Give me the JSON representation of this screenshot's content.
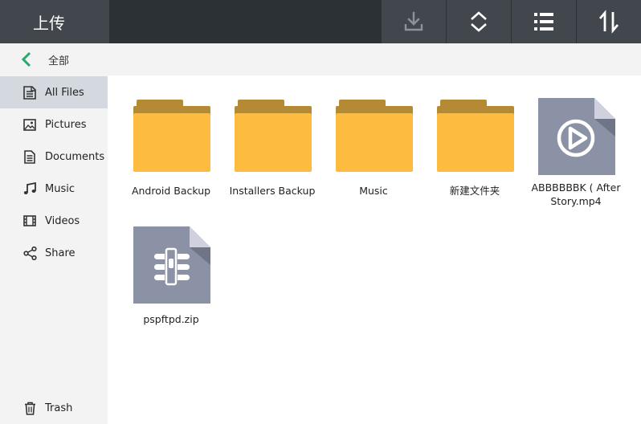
{
  "app": {
    "title": "上传"
  },
  "toolbar": {
    "buttons": [
      {
        "name": "upload-button",
        "icon": "download-icon",
        "color": "#8c9298"
      },
      {
        "name": "sort-order-button",
        "icon": "chevron-up-down-icon",
        "color": "#ffffff"
      },
      {
        "name": "list-view-button",
        "icon": "list-icon",
        "color": "#ffffff"
      },
      {
        "name": "sort-button",
        "icon": "sort-arrows-icon",
        "color": "#ffffff"
      }
    ]
  },
  "breadcrumb": {
    "back_icon": "chevron-left-icon",
    "current": "全部",
    "accent": "#27a96a"
  },
  "sidebar": {
    "items": [
      {
        "label": "All Files",
        "icon": "all-files-icon",
        "active": true
      },
      {
        "label": "Pictures",
        "icon": "picture-icon",
        "active": false
      },
      {
        "label": "Documents",
        "icon": "document-icon",
        "active": false
      },
      {
        "label": "Music",
        "icon": "music-note-icon",
        "active": false
      },
      {
        "label": "Videos",
        "icon": "film-icon",
        "active": false
      },
      {
        "label": "Share",
        "icon": "share-icon",
        "active": false
      }
    ],
    "trash": {
      "label": "Trash",
      "icon": "trash-icon"
    }
  },
  "files": {
    "items": [
      {
        "name": "Android Backup",
        "type": "folder"
      },
      {
        "name": "Installers Backup",
        "type": "folder"
      },
      {
        "name": "Music",
        "type": "folder"
      },
      {
        "name": "新建文件夹",
        "type": "folder"
      },
      {
        "name_line1": "ABBBBBBK ( After",
        "name_line2": "Story.mp4",
        "type": "video"
      },
      {
        "name": "pspftpd.zip",
        "type": "archive"
      }
    ],
    "folder_color": "#fdbb40",
    "folder_tab_color": "#b48a34",
    "file_color": "#8c92a6"
  }
}
